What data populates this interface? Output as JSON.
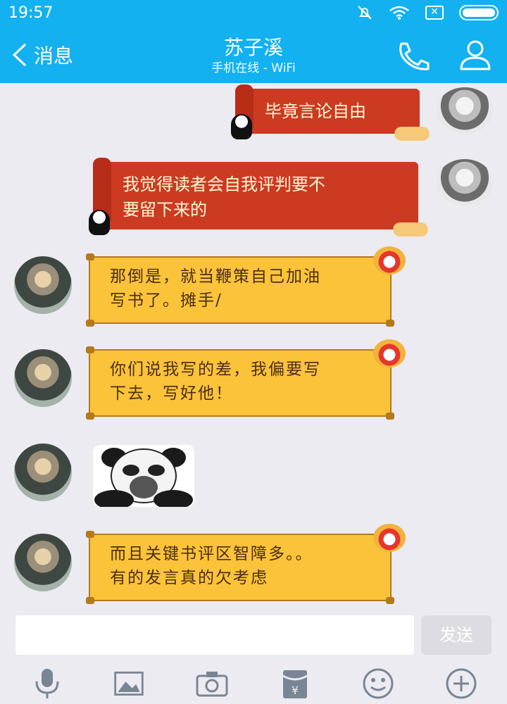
{
  "status_bar": {
    "time": "19:57"
  },
  "header": {
    "back_label": "消息",
    "title": "苏子溪",
    "subtitle": "手机在线 - WiFi"
  },
  "messages": [
    {
      "sender": "self",
      "type": "text",
      "text_lines": [
        "毕竟言论自由"
      ]
    },
    {
      "sender": "self",
      "type": "text",
      "text_lines": [
        "我觉得读者会自我评判要不",
        "要留下来的"
      ]
    },
    {
      "sender": "other",
      "type": "text",
      "text_lines": [
        "那倒是，就当鞭策自己加油",
        "写书了。摊手/"
      ]
    },
    {
      "sender": "other",
      "type": "text",
      "text_lines": [
        "你们说我写的差，我偏要写",
        "下去，写好他！"
      ]
    },
    {
      "sender": "other",
      "type": "sticker",
      "sticker": "panda-face-sticker"
    },
    {
      "sender": "other",
      "type": "text",
      "text_lines": [
        "而且关键书评区智障多。。",
        "有的发言真的欠考虑"
      ]
    }
  ],
  "composer": {
    "input_value": "",
    "send_label": "发送"
  },
  "toolbar_icons": [
    "microphone-icon",
    "image-icon",
    "camera-icon",
    "red-packet-icon",
    "emoji-icon",
    "plus-icon"
  ],
  "colors": {
    "header": "#13b1f0",
    "background": "#ebebf1",
    "red_bubble": "#cc3a22",
    "yellow_bubble": "#fbc33a"
  }
}
